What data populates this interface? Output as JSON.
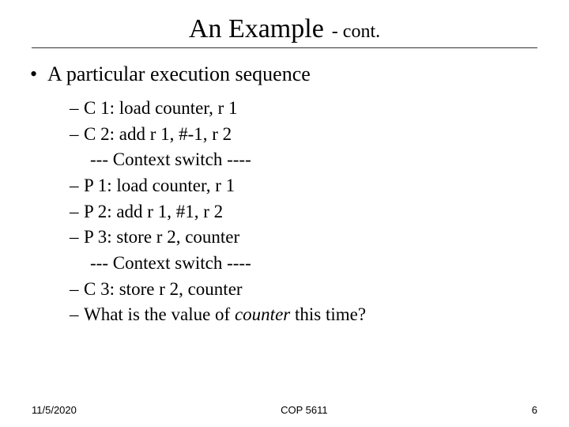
{
  "title": {
    "main": "An Example",
    "suffix": "- cont."
  },
  "bullet": {
    "marker": "•",
    "text": "A particular execution sequence"
  },
  "items": [
    {
      "dash": "–",
      "text": "C 1: load counter, r 1",
      "indent": false
    },
    {
      "dash": "–",
      "text": "C 2: add r 1, #-1, r 2",
      "indent": false
    },
    {
      "dash": "",
      "text": "--- Context switch ----",
      "indent": true
    },
    {
      "dash": "–",
      "text": "P 1:  load counter, r 1",
      "indent": false
    },
    {
      "dash": "–",
      "text": "P 2:  add  r 1, #1, r 2",
      "indent": false
    },
    {
      "dash": "–",
      "text": "P 3:  store r 2, counter",
      "indent": false
    },
    {
      "dash": "",
      "text": "--- Context switch ----",
      "indent": true
    },
    {
      "dash": "–",
      "text": "C 3: store r 2, counter",
      "indent": false
    }
  ],
  "question": {
    "dash": "–",
    "before": "What is the value of ",
    "italic": "counter",
    "after": " this time?"
  },
  "footer": {
    "date": "11/5/2020",
    "center": "COP 5611",
    "page": "6"
  }
}
